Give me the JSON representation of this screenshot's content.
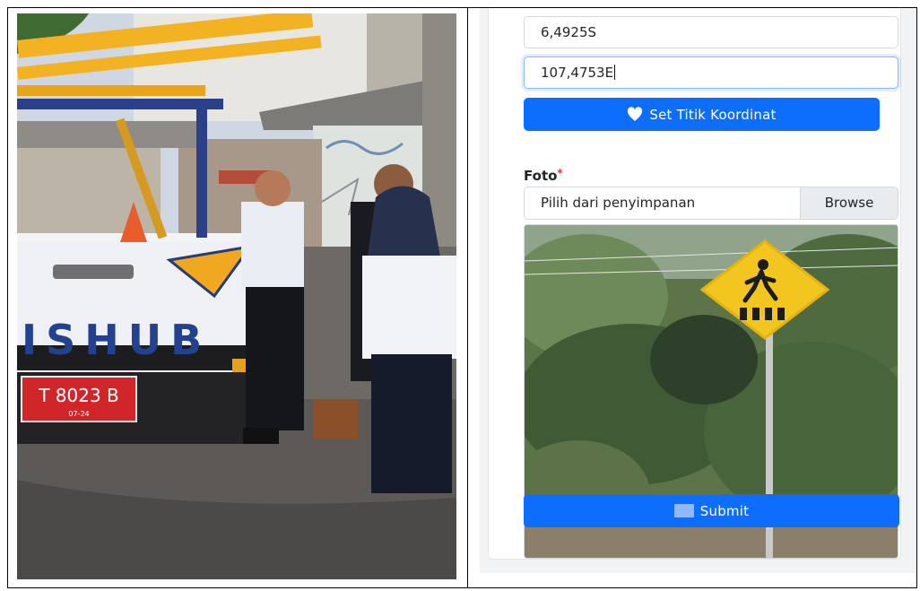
{
  "location": {
    "latitude": "6,4925S",
    "longitude": "107,4753E"
  },
  "buttons": {
    "set_coordinate": "Set Titik Koordinat",
    "submit": "Submit"
  },
  "photo_section": {
    "label": "Foto",
    "required_mark": "*",
    "file_placeholder": "Pilih dari penyimpanan",
    "browse_label": "Browse"
  },
  "left_photo": {
    "vehicle_text": "ISHUB",
    "plate_number": "T 8023 B",
    "plate_sub": "07-24"
  },
  "colors": {
    "primary": "#0d6efd",
    "required": "#dc3545",
    "sign_yellow": "#f2c61f",
    "plate_red": "#d0262a"
  },
  "icons": {
    "set_coordinate": "heart-icon",
    "submit": "square-icon"
  }
}
